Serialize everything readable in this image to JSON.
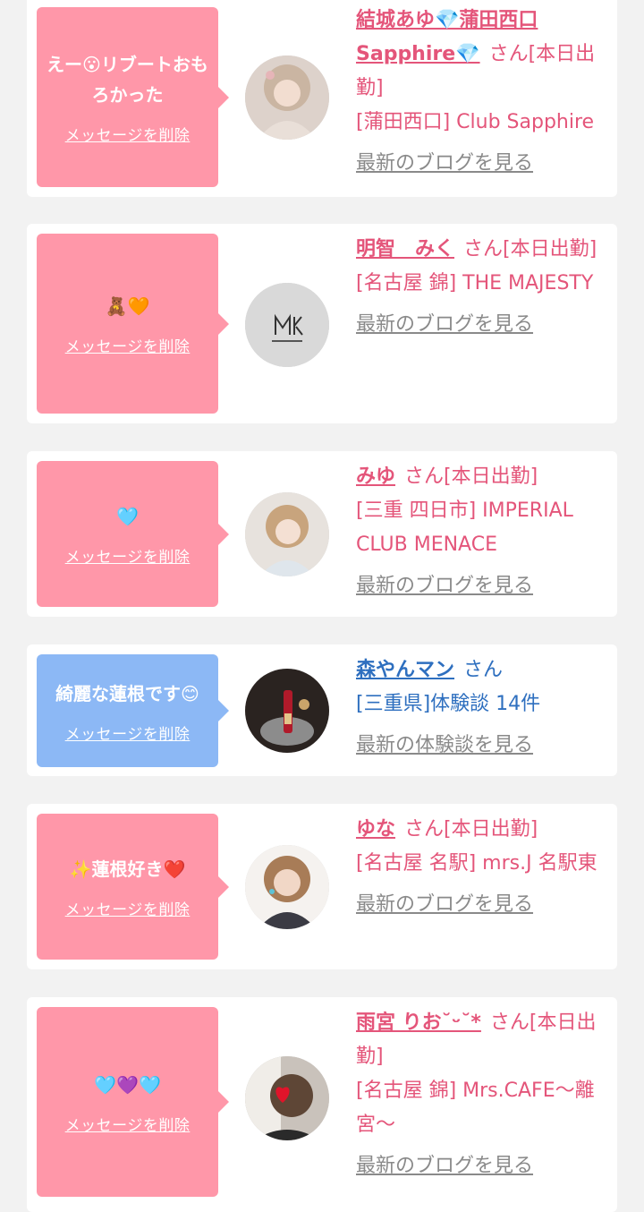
{
  "entries": [
    {
      "message": "えー😮リブートおもろかった",
      "delete_label": "メッセージを削除",
      "name": "結城あゆ💎蒲田西口Sapphire💎",
      "suffix": "さん[本日出勤]",
      "shop": "[蒲田西口] Club Sapphire",
      "more": "最新のブログを見る",
      "avatar_icon": "profile-photo"
    },
    {
      "message": "🧸🧡",
      "delete_label": "メッセージを削除",
      "name": "明智　みく",
      "suffix": "さん[本日出勤]",
      "shop": "[名古屋 錦] THE MAJESTY",
      "more": "最新のブログを見る",
      "avatar_icon": "majesty-logo"
    },
    {
      "message": "🩵",
      "delete_label": "メッセージを削除",
      "name": "みゆ",
      "suffix": "さん[本日出勤]",
      "shop": "[三重 四日市] IMPERIAL CLUB MENACE",
      "more": "最新のブログを見る",
      "avatar_icon": "profile-photo"
    },
    {
      "message": "綺麗な蓮根です😊",
      "delete_label": "メッセージを削除",
      "name": "森やんマン",
      "suffix": "さん",
      "shop": "[三重県]体験談 14件",
      "more": "最新の体験談を見る",
      "avatar_icon": "champagne-photo"
    },
    {
      "message": "✨蓮根好き❤️",
      "delete_label": "メッセージを削除",
      "name": "ゆな",
      "suffix": "さん[本日出勤]",
      "shop": "[名古屋 名駅] mrs.J 名駅東",
      "more": "最新のブログを見る",
      "avatar_icon": "profile-photo"
    },
    {
      "message": "🩵💜🩵",
      "delete_label": "メッセージを削除",
      "name": "雨宮 りお˘ᵕ˘*",
      "suffix": "さん[本日出勤]",
      "shop": "[名古屋 錦] Mrs.CAFE〜離宮〜",
      "more": "最新のブログを見る",
      "avatar_icon": "heart-photo"
    }
  ],
  "colors": {
    "pink_bubble": "#ff97a9",
    "blue_bubble": "#8cb8f5",
    "pink_text": "#e4557a",
    "blue_text": "#2e6fbf",
    "gray_link": "#8a8a8a"
  }
}
